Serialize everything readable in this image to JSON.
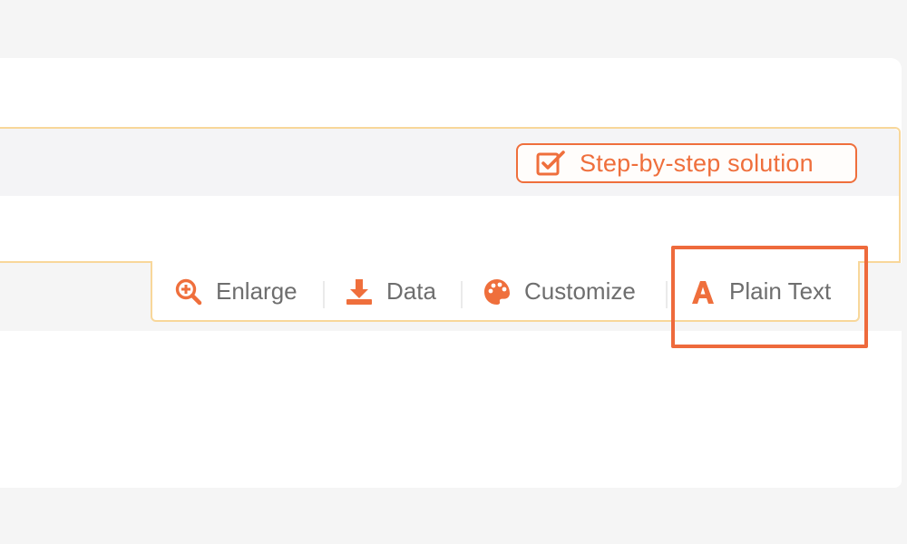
{
  "result": {
    "step_button_label": "Step-by-step solution"
  },
  "toolbar": {
    "items": [
      {
        "label": "Enlarge",
        "icon": "zoom-in-icon"
      },
      {
        "label": "Data",
        "icon": "download-icon"
      },
      {
        "label": "Customize",
        "icon": "palette-icon"
      },
      {
        "label": "Plain Text",
        "icon": "text-a-icon"
      }
    ]
  },
  "colors": {
    "accent": "#ef6f3c",
    "panel_border": "#f8d79a",
    "label_gray": "#6e6e6e",
    "highlight": "#ee6a3c"
  }
}
